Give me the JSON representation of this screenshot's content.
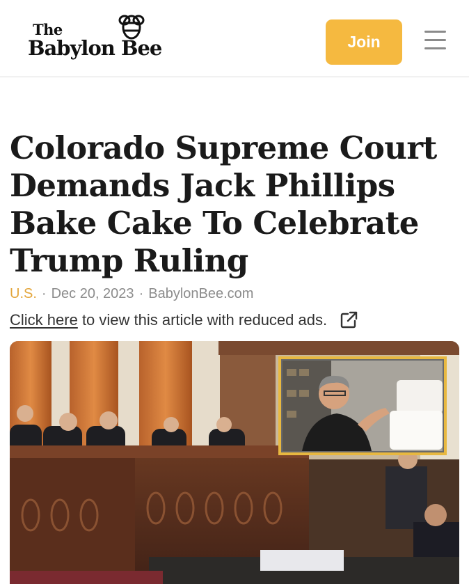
{
  "header": {
    "logo": {
      "line1": "The",
      "line2": "Babylon Bee"
    },
    "join_label": "Join",
    "menu_icon": "hamburger-menu-icon"
  },
  "article": {
    "headline": "Colorado Supreme Court Demands Jack Phillips Bake Cake To Celebrate Trump Ruling",
    "meta": {
      "category": "U.S.",
      "date": "Dec 20, 2023",
      "source": "BabylonBee.com"
    },
    "reduced_ads": {
      "link_text": "Click here",
      "rest_text": "to view this article with reduced ads.",
      "icon": "external-link-icon"
    }
  },
  "colors": {
    "accent": "#f5b940",
    "category": "#e3a53a",
    "meta_text": "#8c8c8c"
  }
}
